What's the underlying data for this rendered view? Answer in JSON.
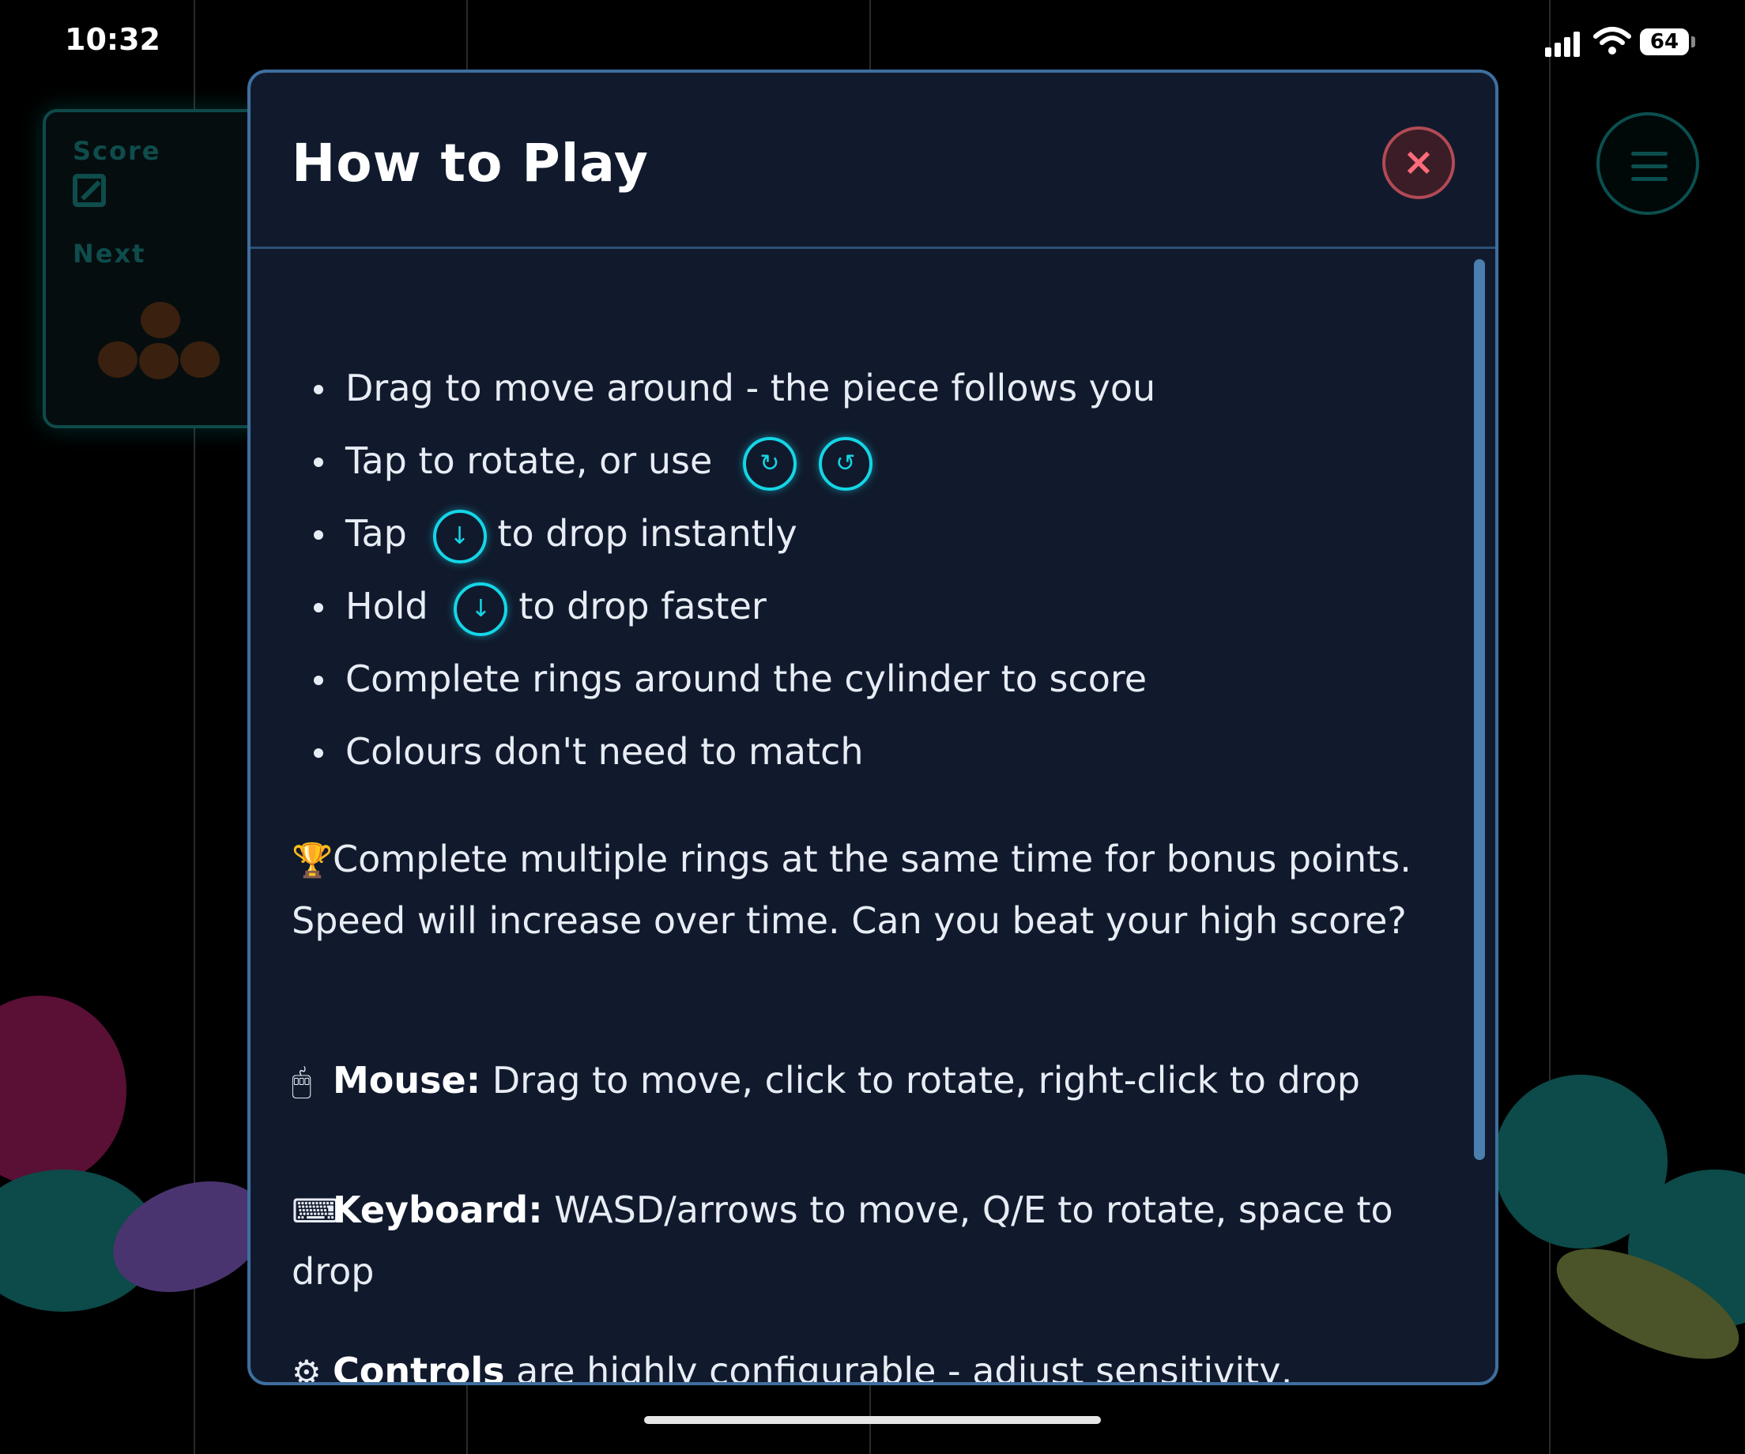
{
  "status_bar": {
    "time": "10:32",
    "battery": "64"
  },
  "hud": {
    "score_label": "Score",
    "next_label": "Next"
  },
  "modal": {
    "title": "How to Play",
    "close_label": "×",
    "rules": [
      {
        "text": "Drag to move around - the piece follows you"
      },
      {
        "before": "Tap to rotate, or use",
        "icons": [
          "↻",
          "↺"
        ]
      },
      {
        "before": "Tap",
        "icon": "↓",
        "after": "to drop instantly"
      },
      {
        "before": "Hold",
        "icon": "↓",
        "after": "to drop faster"
      },
      {
        "text": "Complete rings around the cylinder to score"
      },
      {
        "text": "Colours don't need to match"
      }
    ],
    "bonus": {
      "emoji": "🏆",
      "text": "Complete multiple rings at the same time for bonus points. Speed will increase over time. Can you beat your high score?"
    },
    "mouse": {
      "emoji": "🖱",
      "label": "Mouse:",
      "text": "Drag to move, click to rotate, right-click to drop"
    },
    "keyboard": {
      "emoji": "⌨",
      "label": "Keyboard:",
      "text": "WASD/arrows to move, Q/E to rotate, space to drop"
    },
    "controls": {
      "emoji": "⚙",
      "label": "Controls",
      "text": "are highly configurable - adjust sensitivity, momentum, game style and more in Settings to suit your"
    }
  }
}
